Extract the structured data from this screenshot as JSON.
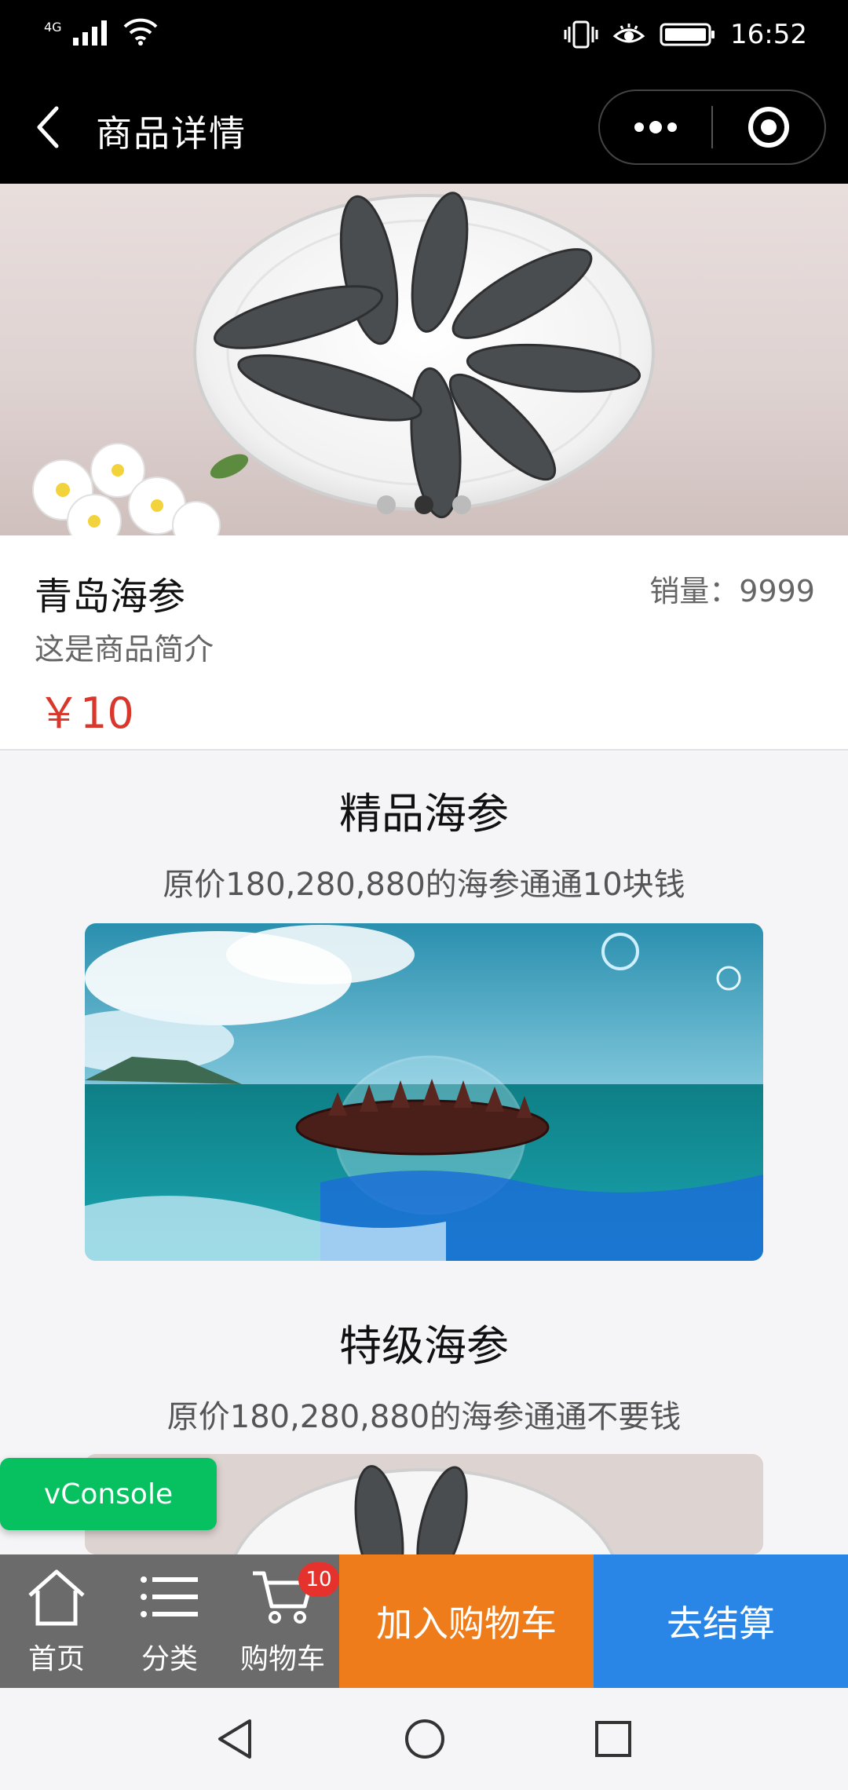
{
  "status_bar": {
    "network": "4G",
    "time": "16:52",
    "icons": [
      "signal-icon",
      "wifi-icon",
      "vibrate-icon",
      "eye-icon",
      "battery-icon"
    ]
  },
  "nav": {
    "title": "商品详情",
    "icons": [
      "back-icon",
      "more-icon",
      "close-target-icon"
    ]
  },
  "banner": {
    "slide_count": 3,
    "active_index": 1
  },
  "product": {
    "name": "青岛海参",
    "sales_label": "销量：9999",
    "intro": "这是商品简介",
    "price": "￥10"
  },
  "sections": [
    {
      "title": "精品海参",
      "description": "原价180,280,880的海参通通10块钱"
    },
    {
      "title": "特级海参",
      "description": "原价180,280,880的海参通通不要钱"
    }
  ],
  "vconsole": {
    "label": "vConsole"
  },
  "action_bar": {
    "tabs": [
      {
        "label": "首页",
        "icon": "home-icon"
      },
      {
        "label": "分类",
        "icon": "list-icon"
      },
      {
        "label": "购物车",
        "icon": "cart-icon",
        "badge": "10"
      }
    ],
    "add_to_cart": "加入购物车",
    "checkout": "去结算",
    "colors": {
      "tab_bg": "#6b6b6b",
      "add_to_cart_bg": "#ef7c1a",
      "checkout_bg": "#2a86e6",
      "badge_bg": "#e5322d"
    }
  },
  "price_color": "#d9362c",
  "system_nav": {
    "icons": [
      "back-triangle-icon",
      "home-circle-icon",
      "recents-square-icon"
    ]
  }
}
